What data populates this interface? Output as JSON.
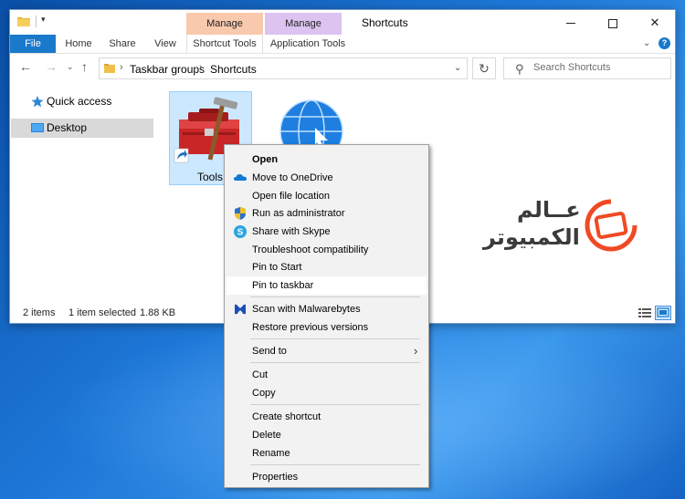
{
  "window": {
    "title": "Shortcuts",
    "contextual_tabs": [
      "Manage",
      "Manage"
    ],
    "ribbon_tabs": {
      "file": "File",
      "home": "Home",
      "share": "Share",
      "view": "View",
      "shortcut_tools": "Shortcut Tools",
      "application_tools": "Application Tools"
    },
    "quick_access_customize": "▾"
  },
  "address": {
    "crumbs": [
      "Taskbar groups",
      "Shortcuts"
    ],
    "separator": "›"
  },
  "search": {
    "placeholder": "Search Shortcuts"
  },
  "nav": {
    "items": [
      {
        "label": "Quick access",
        "icon": "star-icon"
      },
      {
        "label": "Desktop",
        "icon": "desktop-icon"
      }
    ]
  },
  "files": [
    {
      "label": "Tools",
      "icon": "toolbox-shortcut-icon"
    },
    {
      "label": "",
      "icon": "globe-icon"
    }
  ],
  "watermark": {
    "line1": "عــالم",
    "line2": "الكمبيوتر"
  },
  "status": {
    "items": "2 items",
    "selected": "1 item selected",
    "size": "1.88 KB"
  },
  "context_menu": {
    "open": "Open",
    "move_onedrive": "Move to OneDrive",
    "open_location": "Open file location",
    "run_admin": "Run as administrator",
    "share_skype": "Share with Skype",
    "troubleshoot": "Troubleshoot compatibility",
    "pin_start": "Pin to Start",
    "pin_taskbar": "Pin to taskbar",
    "scan_malwarebytes": "Scan with Malwarebytes",
    "restore_versions": "Restore previous versions",
    "send_to": "Send to",
    "cut": "Cut",
    "copy": "Copy",
    "create_shortcut": "Create shortcut",
    "delete": "Delete",
    "rename": "Rename",
    "properties": "Properties"
  },
  "colors": {
    "accent": "#1979ca",
    "selection": "#cce8ff",
    "manage_shortcut": "#f8c9ac",
    "manage_app": "#ddc3f0"
  }
}
